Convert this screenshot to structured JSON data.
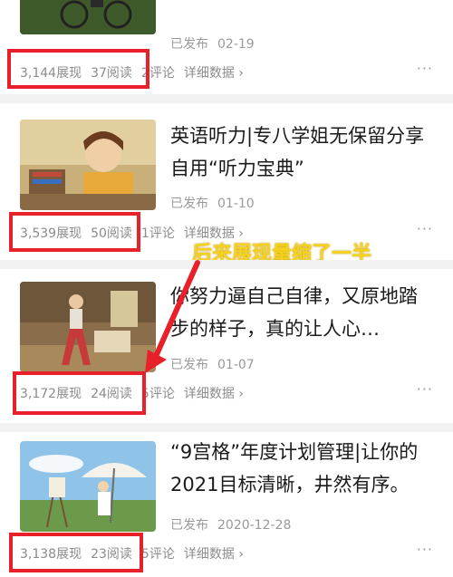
{
  "posts": [
    {
      "title": "",
      "status": "已发布",
      "date": "02-19",
      "views": "3,144展现",
      "reads": "37阅读",
      "comments": "2评论",
      "detail": "详细数据 ›",
      "more": "···"
    },
    {
      "title": "英语听力|专八学姐无保留分享自用“听力宝典”",
      "status": "已发布",
      "date": "01-10",
      "views": "3,539展现",
      "reads": "50阅读",
      "comments": "1评论",
      "detail": "详细数据 ›",
      "more": "···"
    },
    {
      "title": "你努力逼自己自律，又原地踏步的样子，真的让人心…",
      "status": "已发布",
      "date": "01-07",
      "views": "3,172展现",
      "reads": "24阅读",
      "comments": "5评论",
      "detail": "详细数据 ›",
      "more": "···"
    },
    {
      "title": "“9宫格”年度计划管理|让你的2021目标清晰，井然有序。",
      "status": "已发布",
      "date": "2020-12-28",
      "views": "3,138展现",
      "reads": "23阅读",
      "comments": "5评论",
      "detail": "详细数据 ›",
      "more": "···"
    }
  ],
  "annotation": "后来展现量缩了一半",
  "colors": {
    "highlight": "#e8202a",
    "annotation": "#f6d21c"
  }
}
